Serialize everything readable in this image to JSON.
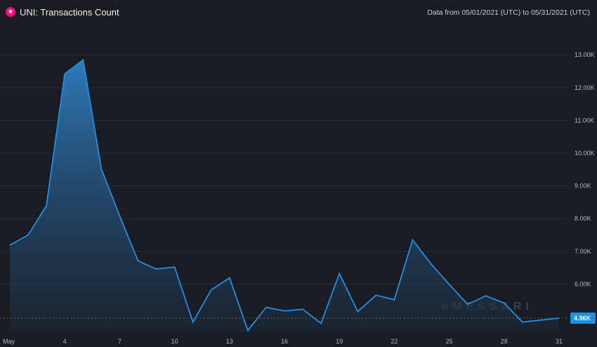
{
  "header": {
    "title": "UNI: Transactions Count",
    "date_range": "Data from 05/01/2021 (UTC) to 05/31/2021 (UTC)",
    "logo_icon": "uniswap-unicorn-icon"
  },
  "watermark": {
    "text": "MESSARI",
    "mark": "M"
  },
  "colors": {
    "line": "#1e8fe6",
    "fill_top": "#2f7fc2",
    "fill_bottom": "#1b2a3c",
    "label_bg": "#1e8fe6",
    "background": "#1b1c22"
  },
  "chart_data": {
    "type": "area",
    "title": "UNI: Transactions Count",
    "x": [
      1,
      2,
      3,
      4,
      5,
      6,
      7,
      8,
      9,
      10,
      11,
      12,
      13,
      14,
      15,
      16,
      17,
      18,
      19,
      20,
      21,
      22,
      23,
      24,
      25,
      26,
      27,
      28,
      29,
      30,
      31
    ],
    "values": [
      7190,
      7500,
      8390,
      12420,
      12850,
      9520,
      8080,
      6710,
      6460,
      6520,
      4840,
      5820,
      6190,
      4580,
      5290,
      5180,
      5230,
      4800,
      6320,
      5160,
      5660,
      5520,
      7350,
      6620,
      5990,
      5380,
      5640,
      5420,
      4840,
      4900,
      4960
    ],
    "x_tick_labels": [
      "May",
      "4",
      "7",
      "10",
      "13",
      "16",
      "19",
      "22",
      "25",
      "28",
      "31"
    ],
    "x_tick_values": [
      1,
      4,
      7,
      10,
      13,
      16,
      19,
      22,
      25,
      28,
      31
    ],
    "y_tick_labels": [
      "6.00K",
      "7.00K",
      "8.00K",
      "9.00K",
      "10.00K",
      "11.00K",
      "12.00K",
      "13.00K"
    ],
    "y_tick_values": [
      6000,
      7000,
      8000,
      9000,
      10000,
      11000,
      12000,
      13000
    ],
    "ylim": [
      4550,
      13820
    ],
    "xlim": [
      1,
      31
    ],
    "last_value_label": "4.96K",
    "grid": true,
    "legend": "none"
  }
}
